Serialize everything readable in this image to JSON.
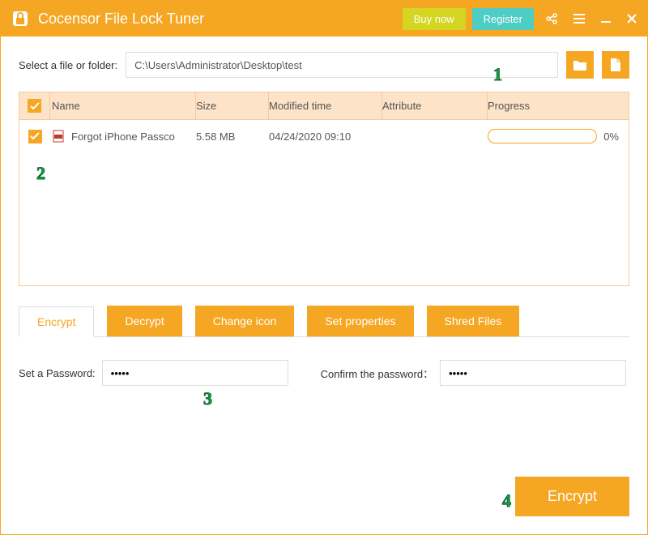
{
  "app": {
    "title": "Cocensor File Lock Tuner"
  },
  "titlebar": {
    "buy": "Buy now",
    "register": "Register"
  },
  "fileSelect": {
    "label": "Select a file or folder:",
    "path": "C:\\Users\\Administrator\\Desktop\\test"
  },
  "table": {
    "headers": {
      "name": "Name",
      "size": "Size",
      "modified": "Modified time",
      "attribute": "Attribute",
      "progress": "Progress"
    },
    "rows": [
      {
        "name": "Forgot iPhone Passco",
        "size": "5.58 MB",
        "modified": "04/24/2020 09:10",
        "attribute": "",
        "progress": "0%"
      }
    ]
  },
  "tabs": {
    "encrypt": "Encrypt",
    "decrypt": "Decrypt",
    "changeIcon": "Change icon",
    "setProps": "Set properties",
    "shred": "Shred Files"
  },
  "password": {
    "setLabel": "Set a Password:",
    "setValue": "•••••",
    "confirmLabel": "Confirm the password：",
    "confirmValue": "•••••"
  },
  "action": {
    "encrypt": "Encrypt"
  },
  "badges": {
    "b1": "1",
    "b2": "2",
    "b3": "3",
    "b4": "4"
  }
}
